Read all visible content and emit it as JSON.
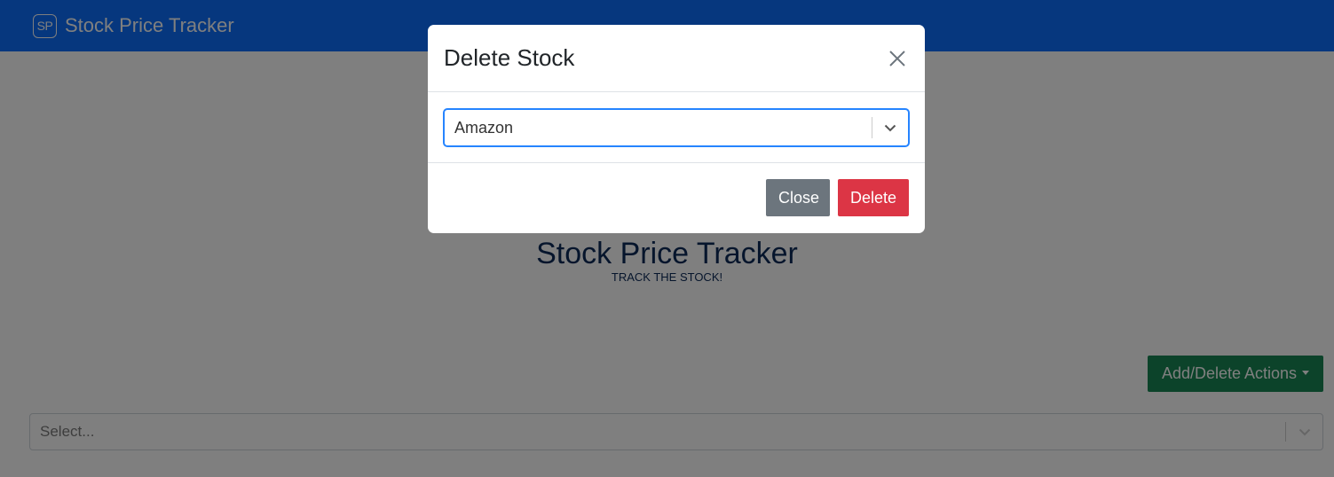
{
  "navbar": {
    "logo_text": "SP",
    "brand": "Stock Price Tracker",
    "bg_color": "#0d6efd"
  },
  "hero": {
    "title": "Stock Price Tracker",
    "subtitle": "TRACK THE STOCK!"
  },
  "actions": {
    "dropdown_label": "Add/Delete Actions",
    "color": "#198754"
  },
  "stock_select": {
    "placeholder": "Select..."
  },
  "modal": {
    "title": "Delete Stock",
    "close_icon": "close-icon",
    "select_value": "Amazon",
    "close_label": "Close",
    "delete_label": "Delete",
    "delete_color": "#dc3545",
    "close_color": "#6c757d"
  }
}
